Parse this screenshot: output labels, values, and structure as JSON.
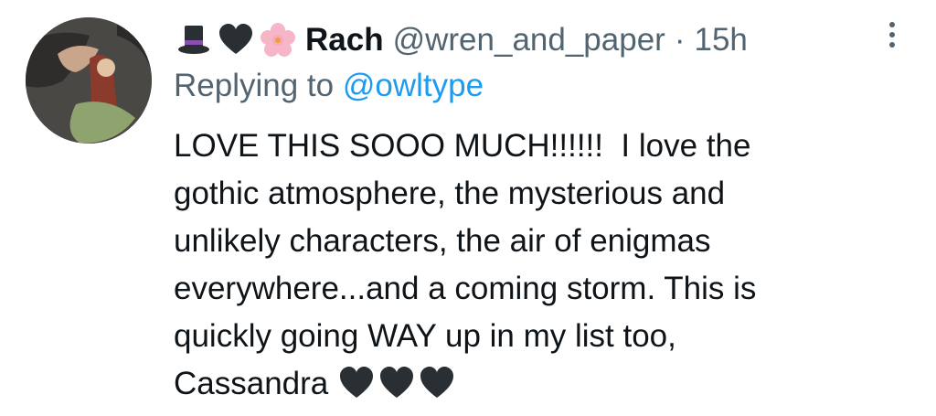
{
  "tweet": {
    "author": {
      "display_name": "Rach",
      "handle": "@wren_and_paper",
      "name_emojis": [
        "top-hat-icon",
        "black-heart-icon",
        "cherry-blossom-icon"
      ]
    },
    "separator": "·",
    "time": "15h",
    "reply": {
      "prefix": "Replying to",
      "target": "@owltype"
    },
    "text": "LOVE THIS SOOO MUCH!!!!!!  I love the\ngothic atmosphere, the mysterious and\nunlikely characters, the air of enigmas\neverywhere...and a coming storm. This is\nquickly going WAY up in my list too,\nCassandra",
    "trailing_emojis": [
      "black-heart-icon",
      "black-heart-icon",
      "black-heart-icon"
    ],
    "menu_icon": "more-options-icon"
  },
  "colors": {
    "text_primary": "#0f1419",
    "text_secondary": "#536471",
    "link": "#1d9bf0",
    "background": "#ffffff"
  }
}
